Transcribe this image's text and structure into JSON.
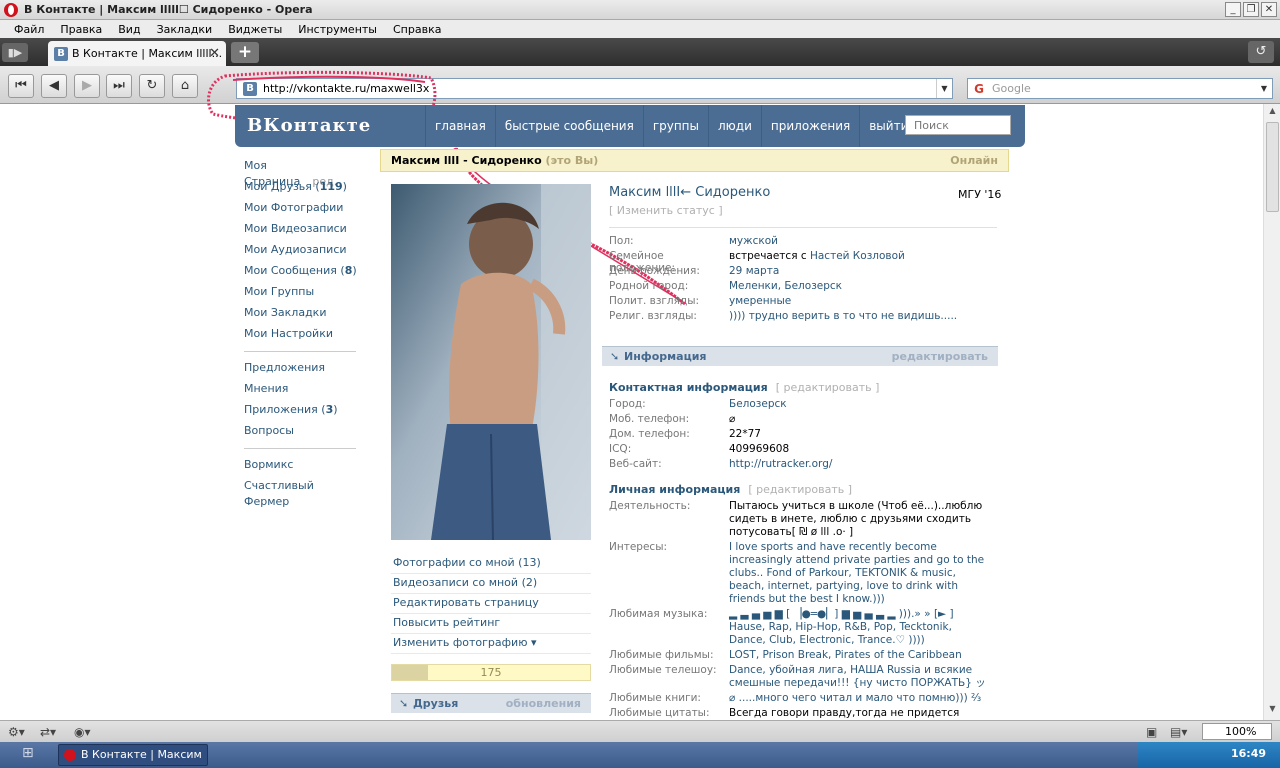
{
  "window": {
    "title": "В Контакте | Максим lllll☐ Сидоренко - Opera"
  },
  "menu": [
    "Файл",
    "Правка",
    "Вид",
    "Закладки",
    "Виджеты",
    "Инструменты",
    "Справка"
  ],
  "tab": {
    "title": "В Контакте | Максим lllll..."
  },
  "address": {
    "url": "http://vkontakte.ru/maxwell3x"
  },
  "search": {
    "placeholder": "Google"
  },
  "vk": {
    "logo": "ВКонтакте",
    "nav": [
      "главная",
      "быстрые сообщения",
      "группы",
      "люди",
      "приложения",
      "выйти"
    ],
    "search_placeholder": "Поиск"
  },
  "left_menu": {
    "group1": [
      {
        "label": "Моя Страница",
        "extra": "ред."
      },
      {
        "label": "Мои Друзья",
        "count": "119"
      },
      {
        "label": "Мои Фотографии"
      },
      {
        "label": "Мои Видеозаписи"
      },
      {
        "label": "Мои Аудиозаписи"
      },
      {
        "label": "Мои Сообщения",
        "count": "8"
      },
      {
        "label": "Мои Группы"
      },
      {
        "label": "Мои Закладки"
      },
      {
        "label": "Мои Настройки"
      }
    ],
    "group2": [
      {
        "label": "Предложения"
      },
      {
        "label": "Мнения"
      },
      {
        "label": "Приложения",
        "count": "3"
      },
      {
        "label": "Вопросы"
      }
    ],
    "group3": [
      {
        "label": "Вормикс"
      },
      {
        "label": "Счастливый Фермер"
      }
    ]
  },
  "profile": {
    "bar_name": "Максим lllI - Сидоренко",
    "bar_you": "(это Вы)",
    "online": "Онлайн",
    "name": "Максим lllI← Сидоренко",
    "change_status": "[ Изменить статус ]",
    "university": "МГУ '16",
    "basic": [
      {
        "label": "Пол:",
        "value": "мужской"
      },
      {
        "label": "Семейное положение:",
        "value": "встречается с ",
        "link": "Настей Козловой"
      },
      {
        "label": "День рождения:",
        "value": "",
        "link": "29 марта"
      },
      {
        "label": "Родной город:",
        "value": "",
        "link": "Меленки, Белозерск"
      },
      {
        "label": "Полит. взгляды:",
        "value": "умеренные"
      },
      {
        "label": "Религ. взгляды:",
        "value": ")))) трудно верить в то что не видишь....."
      }
    ],
    "info_header": "Информация",
    "info_edit": "редактировать",
    "contact_title": "Контактная информация",
    "contact_edit": "[ редактировать ]",
    "contact": [
      {
        "label": "Город:",
        "value": "Белозерск",
        "link": true
      },
      {
        "label": "Моб. телефон:",
        "value": "⌀"
      },
      {
        "label": "Дом. телефон:",
        "value": "22*77"
      },
      {
        "label": "ICQ:",
        "value": "409969608"
      },
      {
        "label": "Веб-сайт:",
        "value": "http://rutracker.org/",
        "link": true
      }
    ],
    "personal_title": "Личная информация",
    "personal_edit": "[ редактировать ]",
    "personal": [
      {
        "label": "Деятельность:",
        "value": "Пытаюсь учиться в школе (Чтоб её...)..люблю сидеть в инете, люблю с друзьями сходить потусовать[ ₪ ø lll .o· ]"
      },
      {
        "label": "Интересы:",
        "value": "I love sports and have recently become increasingly attend private parties and go to the clubs.. Fond of Parkour, TEKTONIK & music, beach, internet, partying, love to drink with friends but the best I know.)))",
        "link": true
      },
      {
        "label": "Любимая музыка:",
        "value": "▂ ▃ ▄ ▅ ▆ [ ▕●═●▏] ▆ ▅ ▄ ▃ ▂ ))).» » [► ] Hause, Rap, Hip-Hop, R&B, Pop, Tecktonik, Dance, Club, Electronic, Trance.♡ ))))",
        "link": true
      },
      {
        "label": "Любимые фильмы:",
        "value": "LOST, Prison Break, Pirates of the Caribbean",
        "link": true
      },
      {
        "label": "Любимые телешоу:",
        "value": "Dance, убойная лига, НАША Russia и всякие смешные передачи!!! {ну чисто ПОРЖАТЬ} ッ",
        "link": true
      },
      {
        "label": "Любимые книги:",
        "value": "⌀ .....много чего читал и мало что помню))) ⅔",
        "link": true
      },
      {
        "label": "Любимые цитаты:",
        "value": "Всегда говори правду,тогда не придется"
      }
    ]
  },
  "photo_links": [
    "Фотографии со мной (13)",
    "Видеозаписи со мной (2)",
    "Редактировать страницу",
    "Повысить рейтинг",
    "Изменить фотографию ▾"
  ],
  "rating": {
    "value": "175",
    "fraction": 0.18
  },
  "friends": {
    "title": "Друзья",
    "updates": "обновления"
  },
  "statusbar": {
    "zoom": "100%"
  },
  "taskbar": {
    "task": "В Контакте | Максим ...",
    "clock": "16:49"
  }
}
